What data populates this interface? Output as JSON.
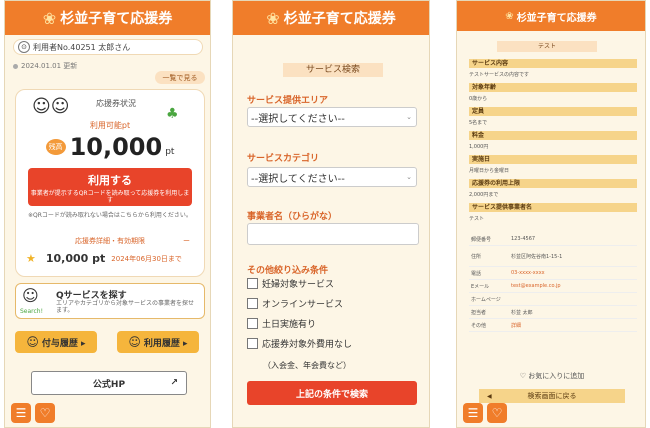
{
  "app": {
    "title": "杉並子育て応援券",
    "logo_icon": "sprout-logo-icon"
  },
  "home": {
    "user_id": "利用者No.40251  太郎さん",
    "date": "2024.01.01  更新",
    "list_button": "一覧で見る",
    "card_title": "応援券状況",
    "available_label": "利用可能pt",
    "badge": "残高",
    "points": "10,000",
    "points_unit": "pt",
    "use_button": {
      "title": "利用する",
      "sub": "事業者が提示するQRコードを読み取って応援券を利用します"
    },
    "notes": "※QRコードが読み取れない場合はこちらから利用ください。",
    "detail_link": "応援券詳細・有効期限",
    "detail_dash": "ー",
    "voucher_points": "10,000 pt",
    "voucher_expiry": "2024年06月30日まで",
    "search": {
      "mascot_label": "Search!",
      "title": "Qサービスを探す",
      "sub": "エリアやカテゴリから対象サービスの事業者を探せます。"
    },
    "history_buttons": [
      "付与履歴 ▸",
      "利用履歴 ▸"
    ],
    "hp_button": "公式HP",
    "hp_ext_icon": "↗"
  },
  "search_page": {
    "title": "サービス検索",
    "area_label": "サービス提供エリア",
    "area_value": "--選択してください--",
    "category_label": "サービスカテゴリ",
    "category_value": "--選択してください--",
    "name_label": "事業者名（ひらがな）",
    "filters_label": "その他絞り込み条件",
    "filters": [
      "妊婦対象サービス",
      "オンラインサービス",
      "土日実施有り",
      "応援券対象外費用なし"
    ],
    "filter_note": "（入会金、年会費など）",
    "submit": "上記の条件で検索"
  },
  "detail_page": {
    "pill": "テスト",
    "sections": [
      {
        "title": "サービス内容",
        "value": "テストサービスの内容です"
      },
      {
        "title": "対象年齢",
        "value": "0歳から"
      },
      {
        "title": "定員",
        "value": "5名まで"
      },
      {
        "title": "料金",
        "value": "1,000円"
      },
      {
        "title": "実施日",
        "value": "月曜日から金曜日"
      },
      {
        "title": "応援券の利用上限",
        "value": "2,000円まで"
      },
      {
        "title": "サービス提供事業者名",
        "value": "テスト"
      }
    ],
    "table": [
      {
        "k": "郵便番号",
        "v": "123-4567",
        "red": false
      },
      {
        "k": "住所",
        "v": "杉並区阿佐谷南1-15-1",
        "red": false
      },
      {
        "k": "電話",
        "v": "03-xxxx-xxxx",
        "red": true
      },
      {
        "k": "Eメール",
        "v": "test@example.co.jp",
        "red": true
      },
      {
        "k": "ホームページ",
        "v": "",
        "red": false
      },
      {
        "k": "担当者",
        "v": "杉並 太郎",
        "red": false
      },
      {
        "k": "その他",
        "v": "詳細",
        "red": true
      }
    ],
    "fav": "♡ お気に入りに追加",
    "back": "検索画面に戻る"
  }
}
